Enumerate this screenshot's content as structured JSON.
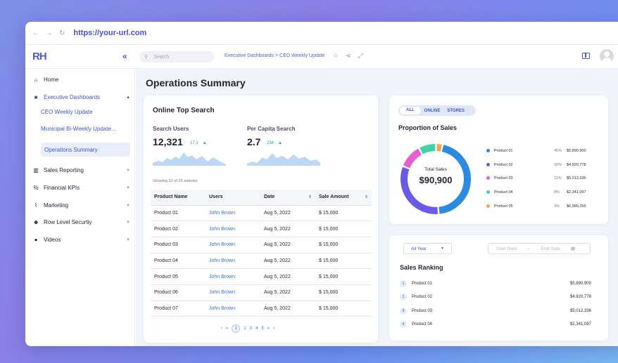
{
  "browser": {
    "url": "https://your-url.com"
  },
  "app": {
    "logo": "RH",
    "search_placeholder": "Search",
    "breadcrumb": "Executive Dashboards > CEO Weekly Update"
  },
  "sidebar": {
    "home": "Home",
    "exec": "Executive Dashboards",
    "sub1": "CEO Weekly Update",
    "sub2": "Municipal Bi-Weekly Update...",
    "sub3": "Operations Summary",
    "sales": "Sales Reporting",
    "kpi": "Financial KPIs",
    "marketing": "Marketing",
    "rls": "Row Level Securtiy",
    "videos": "Videos"
  },
  "page": {
    "title": "Operations Summary"
  },
  "top_search": {
    "title": "Online Top Search",
    "k1_label": "Search Users",
    "k1_value": "12,321",
    "k1_change": "17.1",
    "k2_label": "Per Capita Search",
    "k2_value": "2.7",
    "k2_change": "234",
    "showing": "Showing 10 of 25 enteries",
    "headers": [
      "Product Name",
      "Users",
      "Date",
      "Sale Amount"
    ],
    "rows": [
      [
        "Product 01",
        "John Brown",
        "Aug 5, 2022",
        "$ 15,000"
      ],
      [
        "Product 02",
        "John Brown",
        "Aug 5, 2022",
        "$ 15,000"
      ],
      [
        "Product 03",
        "John Brown",
        "Aug 5, 2022",
        "$ 15,000"
      ],
      [
        "Product 04",
        "John Brown",
        "Aug 5, 2022",
        "$ 15,000"
      ],
      [
        "Product 05",
        "John Brown",
        "Aug 5, 2022",
        "$ 15,000"
      ],
      [
        "Product 06",
        "John Brown",
        "Aug 5, 2022",
        "$ 15,000"
      ],
      [
        "Product 07",
        "John Brown",
        "Aug 5, 2022",
        "$ 15,000"
      ]
    ],
    "pages": [
      "1",
      "2",
      "3",
      "4",
      "5"
    ]
  },
  "proportion": {
    "toggle": [
      "ALL",
      "ONLINE",
      "STORES"
    ],
    "title": "Proportion of Sales",
    "center_label": "Total Sales",
    "center_value": "$90,900",
    "legend": [
      {
        "name": "Product 01",
        "pct": "45%",
        "amt": "$5,890,900",
        "color": "#2b8be0"
      },
      {
        "name": "Product 02",
        "pct": "32%",
        "amt": "$4,920,778",
        "color": "#6a5be6"
      },
      {
        "name": "Product 03",
        "pct": "11%",
        "amt": "$5,012,336",
        "color": "#e85fd0"
      },
      {
        "name": "Product 04",
        "pct": "8%",
        "amt": "$2,341,097",
        "color": "#3fd4a8"
      },
      {
        "name": "Product 05",
        "pct": "3%",
        "amt": "$6,989,256",
        "color": "#f5a445"
      }
    ]
  },
  "ranking": {
    "year": "All Year",
    "start": "Start Date",
    "end": "End Date",
    "title": "Sales Ranking",
    "items": [
      {
        "rank": "1",
        "name": "Product 01",
        "value": "$5,890,900"
      },
      {
        "rank": "2",
        "name": "Product 02",
        "value": "$4,920,778"
      },
      {
        "rank": "3",
        "name": "Product 03",
        "value": "$5,012,336"
      },
      {
        "rank": "4",
        "name": "Product 04",
        "value": "$2,341,097"
      }
    ]
  },
  "colors": {
    "accent": "#3d56c9",
    "positive": "#14a88b"
  }
}
